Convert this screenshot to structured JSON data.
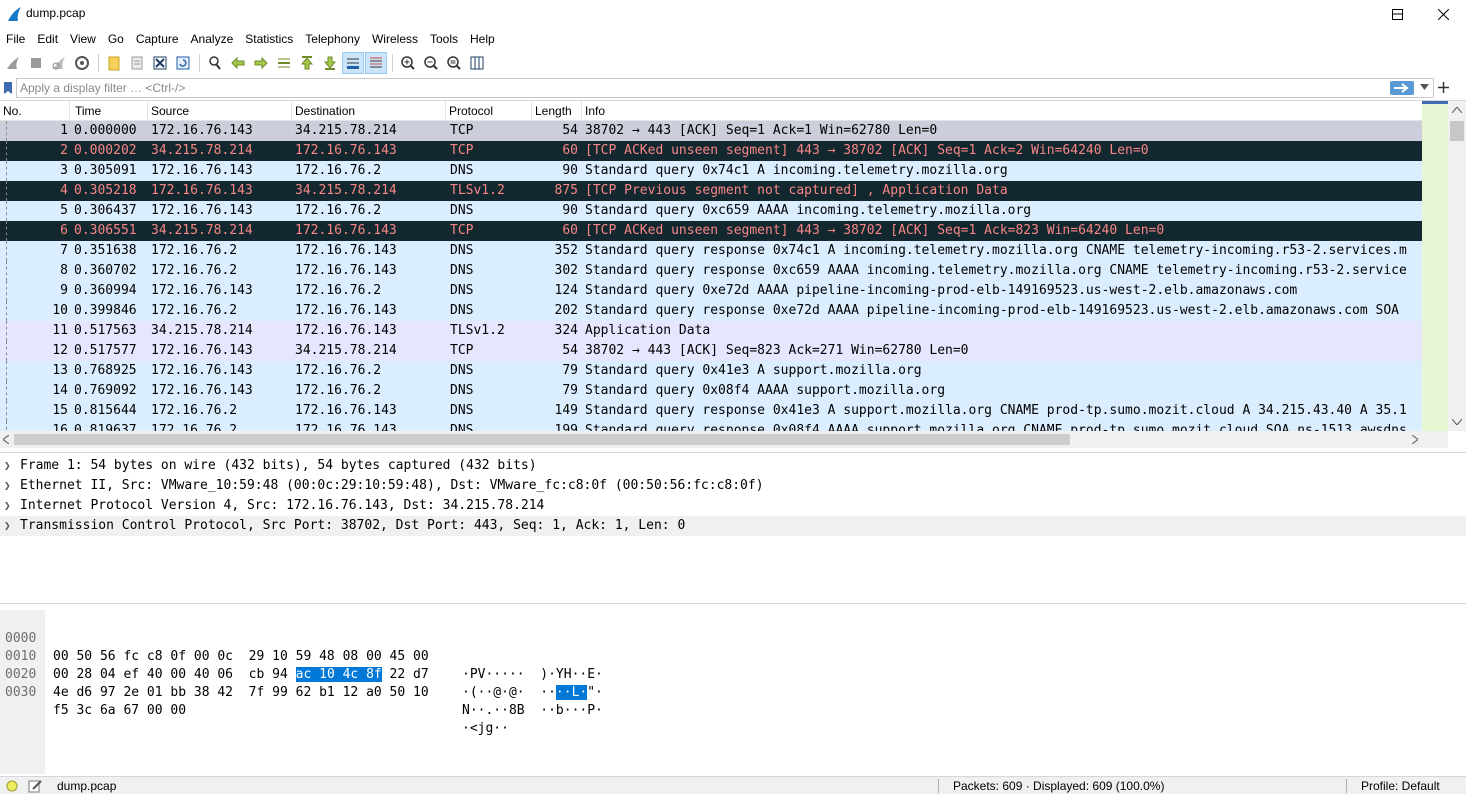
{
  "window": {
    "title": "dump.pcap"
  },
  "menu": [
    "File",
    "Edit",
    "View",
    "Go",
    "Capture",
    "Analyze",
    "Statistics",
    "Telephony",
    "Wireless",
    "Tools",
    "Help"
  ],
  "filter": {
    "placeholder": "Apply a display filter … <Ctrl-/>"
  },
  "columns": {
    "no": "No.",
    "time": "Time",
    "source": "Source",
    "destination": "Destination",
    "protocol": "Protocol",
    "length": "Length",
    "info": "Info"
  },
  "packets": [
    {
      "no": "1",
      "time": "0.000000",
      "src": "172.16.76.143",
      "dst": "34.215.78.214",
      "proto": "TCP",
      "len": "54",
      "info": "38702 → 443 [ACK] Seq=1 Ack=1 Win=62780 Len=0",
      "style": "selected"
    },
    {
      "no": "2",
      "time": "0.000202",
      "src": "34.215.78.214",
      "dst": "172.16.76.143",
      "proto": "TCP",
      "len": "60",
      "info": "[TCP ACKed unseen segment] 443 → 38702 [ACK] Seq=1 Ack=2 Win=64240 Len=0",
      "style": "bad"
    },
    {
      "no": "3",
      "time": "0.305091",
      "src": "172.16.76.143",
      "dst": "172.16.76.2",
      "proto": "DNS",
      "len": "90",
      "info": "Standard query 0x74c1 A incoming.telemetry.mozilla.org",
      "style": "udp"
    },
    {
      "no": "4",
      "time": "0.305218",
      "src": "172.16.76.143",
      "dst": "34.215.78.214",
      "proto": "TLSv1.2",
      "len": "875",
      "info": "[TCP Previous segment not captured] , Application Data",
      "style": "bad"
    },
    {
      "no": "5",
      "time": "0.306437",
      "src": "172.16.76.143",
      "dst": "172.16.76.2",
      "proto": "DNS",
      "len": "90",
      "info": "Standard query 0xc659 AAAA incoming.telemetry.mozilla.org",
      "style": "udp"
    },
    {
      "no": "6",
      "time": "0.306551",
      "src": "34.215.78.214",
      "dst": "172.16.76.143",
      "proto": "TCP",
      "len": "60",
      "info": "[TCP ACKed unseen segment] 443 → 38702 [ACK] Seq=1 Ack=823 Win=64240 Len=0",
      "style": "bad"
    },
    {
      "no": "7",
      "time": "0.351638",
      "src": "172.16.76.2",
      "dst": "172.16.76.143",
      "proto": "DNS",
      "len": "352",
      "info": "Standard query response 0x74c1 A incoming.telemetry.mozilla.org CNAME telemetry-incoming.r53-2.services.m",
      "style": "udp"
    },
    {
      "no": "8",
      "time": "0.360702",
      "src": "172.16.76.2",
      "dst": "172.16.76.143",
      "proto": "DNS",
      "len": "302",
      "info": "Standard query response 0xc659 AAAA incoming.telemetry.mozilla.org CNAME telemetry-incoming.r53-2.service",
      "style": "udp"
    },
    {
      "no": "9",
      "time": "0.360994",
      "src": "172.16.76.143",
      "dst": "172.16.76.2",
      "proto": "DNS",
      "len": "124",
      "info": "Standard query 0xe72d AAAA pipeline-incoming-prod-elb-149169523.us-west-2.elb.amazonaws.com",
      "style": "udp"
    },
    {
      "no": "10",
      "time": "0.399846",
      "src": "172.16.76.2",
      "dst": "172.16.76.143",
      "proto": "DNS",
      "len": "202",
      "info": "Standard query response 0xe72d AAAA pipeline-incoming-prod-elb-149169523.us-west-2.elb.amazonaws.com SOA",
      "style": "udp"
    },
    {
      "no": "11",
      "time": "0.517563",
      "src": "34.215.78.214",
      "dst": "172.16.76.143",
      "proto": "TLSv1.2",
      "len": "324",
      "info": "Application Data",
      "style": "tcp"
    },
    {
      "no": "12",
      "time": "0.517577",
      "src": "172.16.76.143",
      "dst": "34.215.78.214",
      "proto": "TCP",
      "len": "54",
      "info": "38702 → 443 [ACK] Seq=823 Ack=271 Win=62780 Len=0",
      "style": "tcp"
    },
    {
      "no": "13",
      "time": "0.768925",
      "src": "172.16.76.143",
      "dst": "172.16.76.2",
      "proto": "DNS",
      "len": "79",
      "info": "Standard query 0x41e3 A support.mozilla.org",
      "style": "udp"
    },
    {
      "no": "14",
      "time": "0.769092",
      "src": "172.16.76.143",
      "dst": "172.16.76.2",
      "proto": "DNS",
      "len": "79",
      "info": "Standard query 0x08f4 AAAA support.mozilla.org",
      "style": "udp"
    },
    {
      "no": "15",
      "time": "0.815644",
      "src": "172.16.76.2",
      "dst": "172.16.76.143",
      "proto": "DNS",
      "len": "149",
      "info": "Standard query response 0x41e3 A support.mozilla.org CNAME prod-tp.sumo.mozit.cloud A 34.215.43.40 A 35.1",
      "style": "udp"
    },
    {
      "no": "16",
      "time": "0.819637",
      "src": "172.16.76.2",
      "dst": "172.16.76.143",
      "proto": "DNS",
      "len": "199",
      "info": "Standard query response 0x08f4 AAAA support.mozilla.org CNAME prod-tp.sumo.mozit.cloud SOA ns-1513.awsdns",
      "style": "udp"
    }
  ],
  "details": [
    "Frame 1: 54 bytes on wire (432 bits), 54 bytes captured (432 bits)",
    "Ethernet II, Src: VMware_10:59:48 (00:0c:29:10:59:48), Dst: VMware_fc:c8:0f (00:50:56:fc:c8:0f)",
    "Internet Protocol Version 4, Src: 172.16.76.143, Dst: 34.215.78.214",
    "Transmission Control Protocol, Src Port: 38702, Dst Port: 443, Seq: 1, Ack: 1, Len: 0"
  ],
  "bytes": [
    {
      "offset": "0000",
      "hex_a": "00 50 56 fc c8 0f 00 0c  29 10 59 48 08 00 45 00",
      "hex_hl": "",
      "hex_b": "",
      "ascii_a": "·PV·····  )·YH··E·",
      "ascii_hl": "",
      "ascii_b": ""
    },
    {
      "offset": "0010",
      "hex_a": "00 28 04 ef 40 00 40 06  cb 94 ",
      "hex_hl": "ac 10 4c 8f",
      "hex_b": " 22 d7",
      "ascii_a": "·(··@·@·  ··",
      "ascii_hl": "··L·",
      "ascii_b": "\"·"
    },
    {
      "offset": "0020",
      "hex_a": "4e d6 97 2e 01 bb 38 42  7f 99 62 b1 12 a0 50 10",
      "hex_hl": "",
      "hex_b": "",
      "ascii_a": "N··.··8B  ··b···P·",
      "ascii_hl": "",
      "ascii_b": ""
    },
    {
      "offset": "0030",
      "hex_a": "f5 3c 6a 67 00 00",
      "hex_hl": "",
      "hex_b": "",
      "ascii_a": "·<jg··",
      "ascii_hl": "",
      "ascii_b": ""
    }
  ],
  "status": {
    "file": "dump.pcap",
    "packets": "Packets: 609 · Displayed: 609 (100.0%)",
    "profile": "Profile: Default"
  },
  "colors": {
    "selected_bg": "#cccedc",
    "bad_bg": "#12272e",
    "bad_fg": "#f78787",
    "udp_bg": "#daeeff",
    "tcp_bg": "#e7e6ff",
    "accent": "#0078d7"
  }
}
